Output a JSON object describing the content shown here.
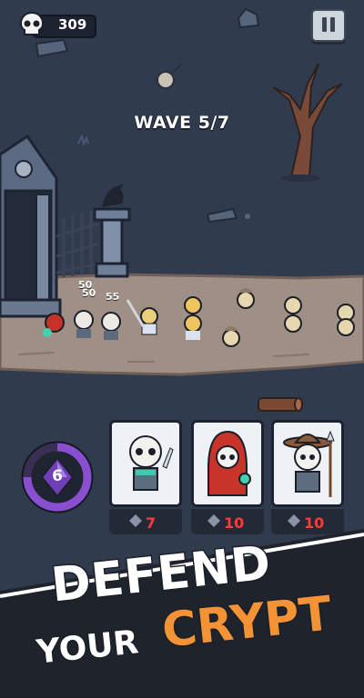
{
  "hud": {
    "score": "309",
    "icons": [
      "skull-icon",
      "pause-icon"
    ]
  },
  "wave": {
    "label": "WAVE 5/7"
  },
  "units": {
    "hp_labels": [
      "50",
      "50",
      "55"
    ]
  },
  "mana": {
    "value": "6",
    "icon": "purple-gem-icon"
  },
  "cards": [
    {
      "name": "Skeleton Warrior",
      "cost": "7",
      "icon": "skeleton-sword-icon"
    },
    {
      "name": "Reaper Mage",
      "cost": "10",
      "icon": "red-reaper-icon"
    },
    {
      "name": "Skeleton Spearman",
      "cost": "10",
      "icon": "skeleton-hat-icon"
    }
  ],
  "banner": {
    "line1": "DEFEND",
    "line2": "YOUR",
    "line3": "CRYPT"
  },
  "colors": {
    "background": "#2f3a4c",
    "path": "#9f8f85",
    "accent_orange": "#f49336",
    "cost_red": "#ff3a3a",
    "mana_purple": "#8a4fd0"
  }
}
